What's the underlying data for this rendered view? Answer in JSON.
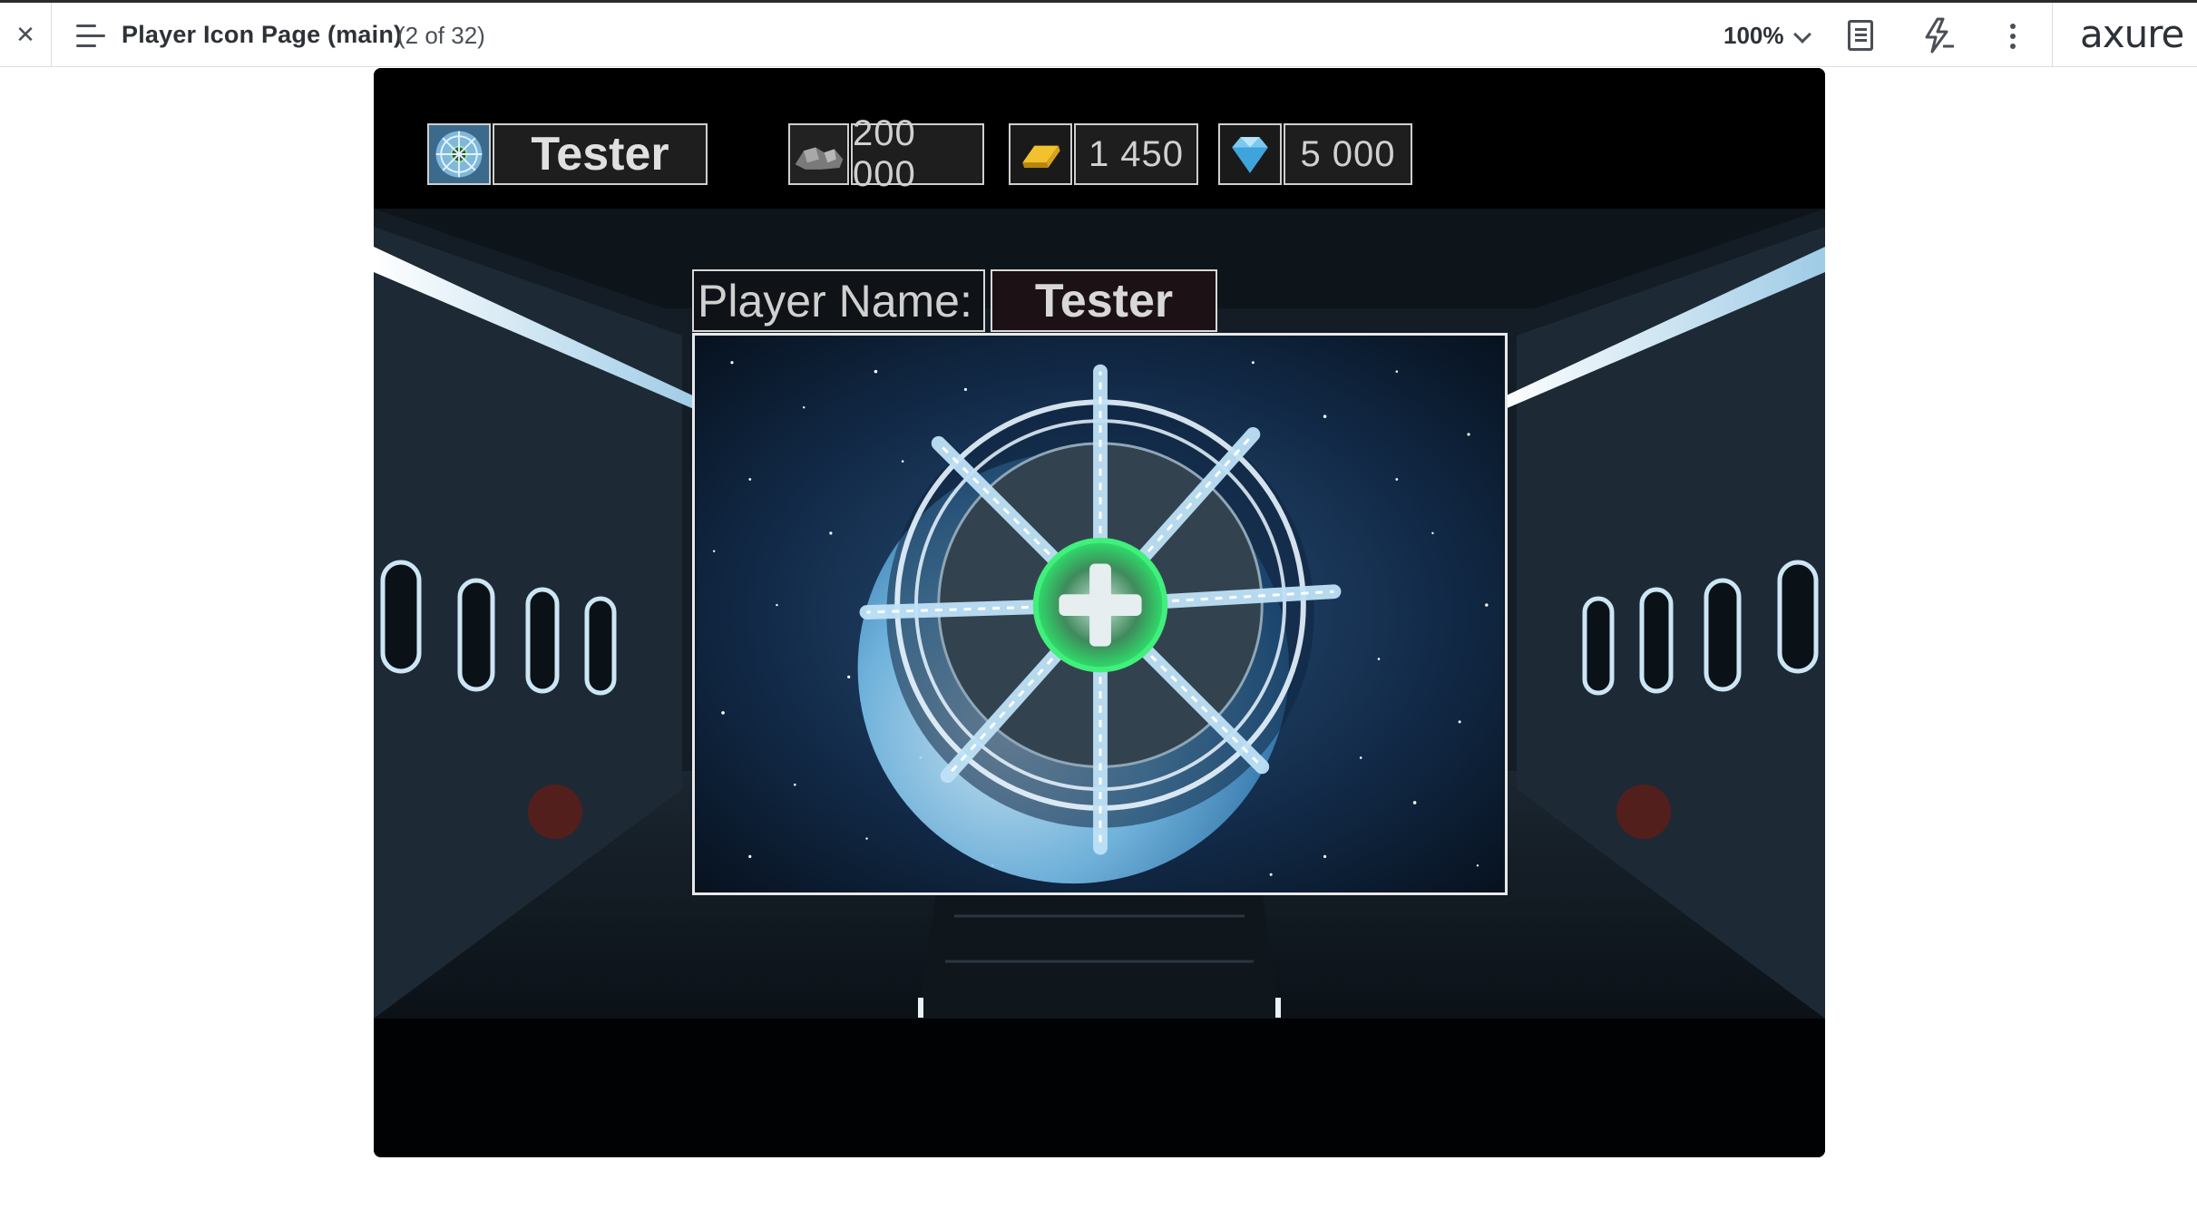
{
  "toolbar": {
    "close_glyph": "✕",
    "page_title": "Player Icon Page (main)",
    "page_count": "(2 of 32)",
    "zoom": "100%",
    "logo": "axure"
  },
  "hud": {
    "player_name": "Tester",
    "resources": [
      {
        "icon": "ore-icon",
        "value": "200 000"
      },
      {
        "icon": "gold-bar-icon",
        "value": "1 450"
      },
      {
        "icon": "diamond-icon",
        "value": "5 000"
      }
    ]
  },
  "profile": {
    "name_label": "Player Name:",
    "name_value": "Tester",
    "avatar": "space-station-icon"
  }
}
